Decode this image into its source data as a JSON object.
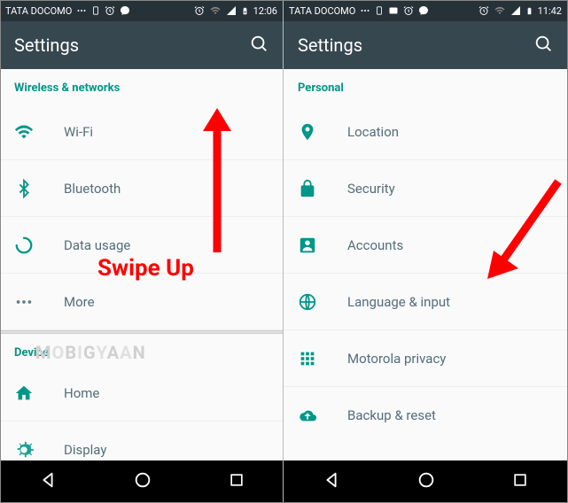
{
  "left": {
    "status": {
      "carrier": "TATA DOCOMO",
      "time": "12:06"
    },
    "appbar": {
      "title": "Settings"
    },
    "section1": {
      "header": "Wireless & networks",
      "items": [
        "Wi-Fi",
        "Bluetooth",
        "Data usage",
        "More"
      ]
    },
    "section2": {
      "header": "Device",
      "items": [
        "Home",
        "Display"
      ]
    },
    "annotation": "Swipe Up"
  },
  "right": {
    "status": {
      "carrier": "TATA DOCOMO",
      "time": "11:42"
    },
    "appbar": {
      "title": "Settings"
    },
    "section1": {
      "header": "Personal",
      "items": [
        "Location",
        "Security",
        "Accounts",
        "Language & input",
        "Motorola privacy",
        "Backup & reset"
      ]
    }
  },
  "watermark": "MOBIGYAAN"
}
